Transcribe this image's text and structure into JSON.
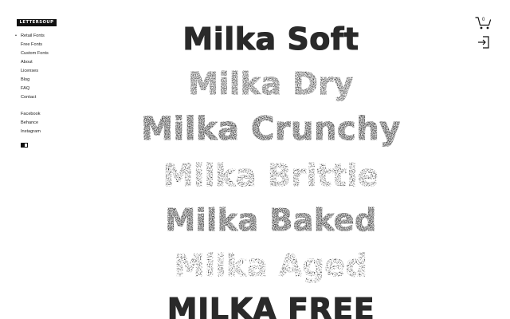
{
  "brand": {
    "logo_text": "LETTERSOUP"
  },
  "nav": {
    "primary": [
      {
        "label": "Retail Fonts",
        "active": true
      },
      {
        "label": "Free Fonts"
      },
      {
        "label": "Custom Fonts"
      },
      {
        "label": "About"
      },
      {
        "label": "Licenses"
      },
      {
        "label": "Blog"
      },
      {
        "label": "FAQ"
      },
      {
        "label": "Contact"
      }
    ],
    "social": [
      {
        "label": "Facebook"
      },
      {
        "label": "Behance"
      },
      {
        "label": "Instagram"
      }
    ],
    "active_bullet": "•"
  },
  "header": {
    "cart_count": "0",
    "cart_icon": "shopping-cart-icon",
    "login_icon": "login-icon"
  },
  "specimens": [
    {
      "label": "Milka Soft"
    },
    {
      "label": "Milka Dry"
    },
    {
      "label": "Milka Crunchy"
    },
    {
      "label": "Milka Brittle"
    },
    {
      "label": "Milka Baked"
    },
    {
      "label": "Milka Aged"
    },
    {
      "label": "MILKA FREE"
    }
  ],
  "colors": {
    "text": "#2b2b2b",
    "background": "#ffffff",
    "logo_bg": "#111111"
  }
}
